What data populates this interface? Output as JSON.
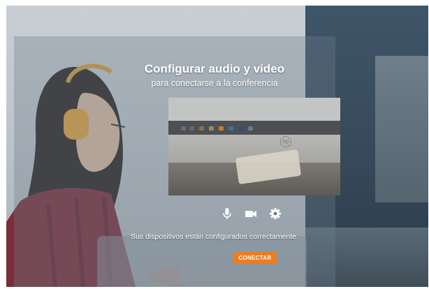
{
  "dialog": {
    "title": "Configurar audio y video",
    "subtitle": "para conectarse a la conferencia",
    "status": "Sus dispositivos están configurados correctamente.",
    "connect_label": "CONECTAR"
  },
  "controls": [
    {
      "name": "microphone-icon"
    },
    {
      "name": "camera-icon"
    },
    {
      "name": "settings-icon"
    }
  ],
  "colors": {
    "accent": "#ef7c1f",
    "text": "#ffffff"
  }
}
